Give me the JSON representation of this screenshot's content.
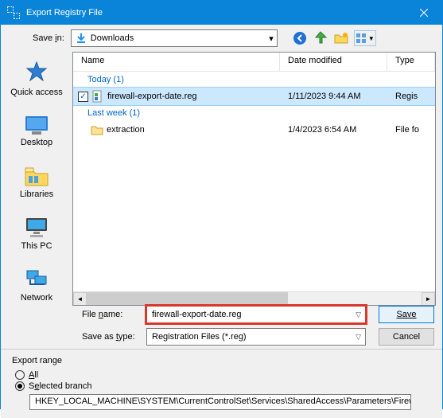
{
  "title": "Export Registry File",
  "savein": {
    "label": "Save in:",
    "value": "Downloads"
  },
  "toolbar": {
    "back": "back",
    "up": "up",
    "newfolder": "newfolder",
    "views": "views"
  },
  "places": {
    "quick": "Quick access",
    "desktop": "Desktop",
    "libraries": "Libraries",
    "thispc": "This PC",
    "network": "Network"
  },
  "columns": {
    "name": "Name",
    "date": "Date modified",
    "type": "Type"
  },
  "groups": [
    {
      "label": "Today (1)",
      "items": [
        {
          "name": "firewall-export-date.reg",
          "date": "1/11/2023 9:44 AM",
          "type": "Regis",
          "selected": true,
          "icon": "reg"
        }
      ]
    },
    {
      "label": "Last week (1)",
      "items": [
        {
          "name": "extraction",
          "date": "1/4/2023 6:54 AM",
          "type": "File fo",
          "selected": false,
          "icon": "folder"
        }
      ]
    }
  ],
  "filename": {
    "label": "File name:",
    "value": "firewall-export-date.reg"
  },
  "filetype": {
    "label": "Save as type:",
    "value": "Registration Files (*.reg)"
  },
  "buttons": {
    "save": "Save",
    "cancel": "Cancel"
  },
  "export": {
    "title": "Export range",
    "all": "All",
    "selected": "Selected branch",
    "path": "HKEY_LOCAL_MACHINE\\SYSTEM\\CurrentControlSet\\Services\\SharedAccess\\Parameters\\FirewallP"
  }
}
